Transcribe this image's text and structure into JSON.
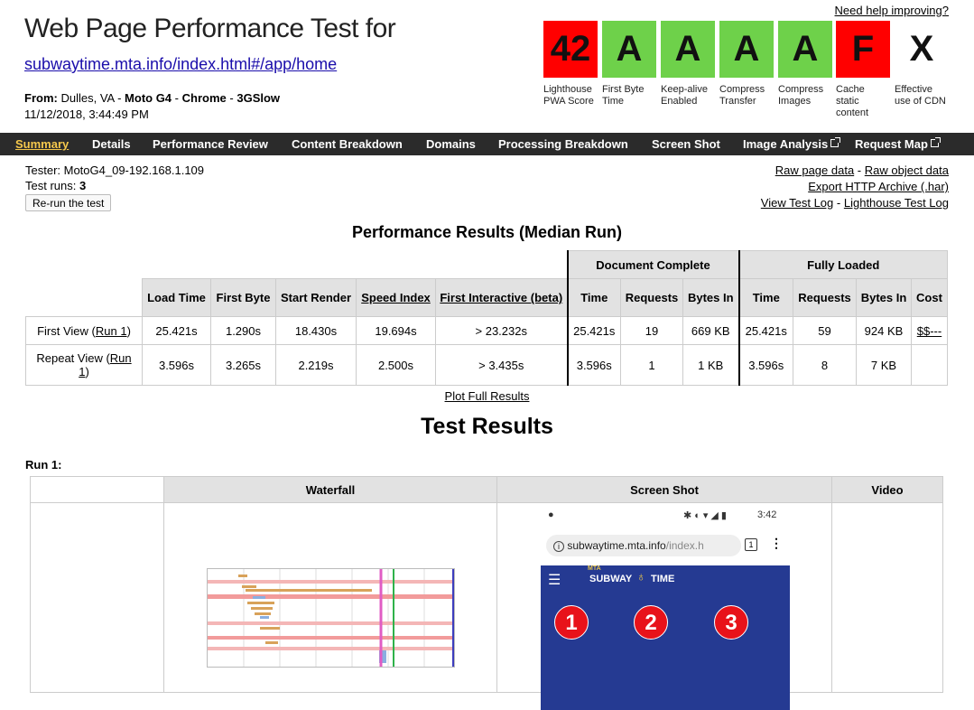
{
  "header": {
    "title": "Web Page Performance Test for",
    "url": "subwaytime.mta.info/index.html#/app/home",
    "from_label": "From:",
    "from_location": "Dulles, VA -",
    "device": "Moto G4",
    "sep1": "-",
    "browser": "Chrome",
    "sep2": "-",
    "connection": "3GSlow",
    "datetime": "11/12/2018, 3:44:49 PM",
    "help_link": "Need help improving?"
  },
  "grades": [
    {
      "value": "42",
      "label": "Lighthouse PWA Score",
      "color": "#ff0000"
    },
    {
      "value": "A",
      "label": "First Byte Time",
      "color": "#6ed14a"
    },
    {
      "value": "A",
      "label": "Keep-alive Enabled",
      "color": "#6ed14a"
    },
    {
      "value": "A",
      "label": "Compress Transfer",
      "color": "#6ed14a"
    },
    {
      "value": "A",
      "label": "Compress Images",
      "color": "#6ed14a"
    },
    {
      "value": "F",
      "label": "Cache static content",
      "color": "#ff0000"
    },
    {
      "value": "X",
      "label": "Effective use of CDN",
      "color": "#ffffff"
    }
  ],
  "nav": [
    "Summary",
    "Details",
    "Performance Review",
    "Content Breakdown",
    "Domains",
    "Processing Breakdown",
    "Screen Shot",
    "Image Analysis",
    "Request Map"
  ],
  "tester": {
    "tester_text": "Tester: MotoG4_09-192.168.1.109",
    "runs_label": "Test runs:",
    "runs_value": "3",
    "rerun_button": "Re-run the test"
  },
  "links": {
    "raw_page": "Raw page data",
    "dash": "-",
    "raw_object": "Raw object data",
    "export_har": "Export HTTP Archive (.har)",
    "view_log": "View Test Log",
    "lighthouse_log": "Lighthouse Test Log"
  },
  "perf": {
    "heading": "Performance Results (Median Run)",
    "group_doc": "Document Complete",
    "group_full": "Fully Loaded",
    "cols": {
      "load_time": "Load Time",
      "first_byte": "First Byte",
      "start_render": "Start Render",
      "speed_index": "Speed Index",
      "first_interactive": "First Interactive (beta)",
      "doc_time": "Time",
      "doc_requests": "Requests",
      "doc_bytes": "Bytes In",
      "full_time": "Time",
      "full_requests": "Requests",
      "full_bytes": "Bytes In",
      "cost": "Cost"
    },
    "rows": [
      {
        "label": "First View (",
        "run_link": "Run 1",
        "label_end": ")",
        "values": [
          "25.421s",
          "1.290s",
          "18.430s",
          "19.694s",
          "> 23.232s",
          "25.421s",
          "19",
          "669 KB",
          "25.421s",
          "59",
          "924 KB",
          "$$---"
        ]
      },
      {
        "label": "Repeat View (",
        "run_link": "Run 1",
        "label_end": ")",
        "values": [
          "3.596s",
          "3.265s",
          "2.219s",
          "2.500s",
          "> 3.435s",
          "3.596s",
          "1",
          "1 KB",
          "3.596s",
          "8",
          "7 KB",
          ""
        ]
      }
    ],
    "plot_link": "Plot Full Results"
  },
  "test_results": {
    "heading": "Test Results",
    "run_label": "Run 1:",
    "col_waterfall": "Waterfall",
    "col_screenshot": "Screen Shot",
    "col_video": "Video",
    "phone": {
      "time": "3:42",
      "url_main": "subwaytime.mta.info",
      "url_path": "/index.h",
      "tab_count": "1",
      "app_brand_top": "MTA",
      "app_brand": "SUBWAY",
      "app_brand2": "TIME",
      "lines": [
        "1",
        "2",
        "3"
      ]
    }
  }
}
